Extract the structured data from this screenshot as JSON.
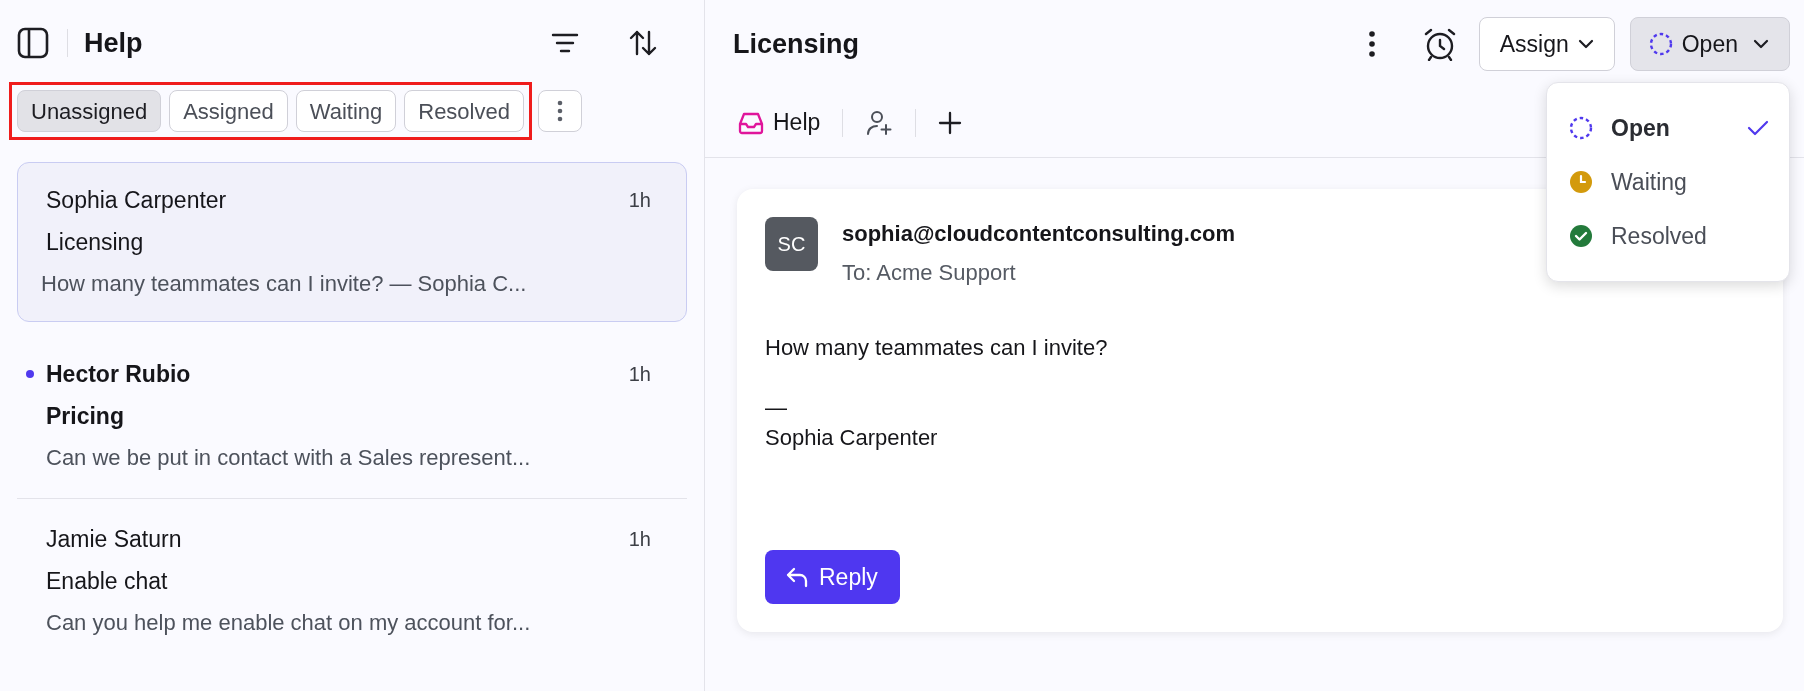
{
  "sidebar": {
    "title": "Help",
    "filters_highlighted": true,
    "filters": [
      {
        "label": "Unassigned",
        "selected": true
      },
      {
        "label": "Assigned",
        "selected": false
      },
      {
        "label": "Waiting",
        "selected": false
      },
      {
        "label": "Resolved",
        "selected": false
      }
    ],
    "conversations": [
      {
        "name": "Sophia Carpenter",
        "time": "1h",
        "subject": "Licensing",
        "preview": "How many teammates can I invite? — Sophia C...",
        "unread": false,
        "selected": true
      },
      {
        "name": "Hector Rubio",
        "time": "1h",
        "subject": "Pricing",
        "preview": "Can we be put in contact with a Sales represent...",
        "unread": true,
        "selected": false
      },
      {
        "name": "Jamie Saturn",
        "time": "1h",
        "subject": "Enable chat",
        "preview": "Can you help me enable chat on my account for...",
        "unread": false,
        "selected": false
      }
    ]
  },
  "conversation": {
    "title": "Licensing",
    "assign_button": "Assign",
    "status_button": "Open",
    "inbox_tab": "Help",
    "message": {
      "initials": "SC",
      "sender": "sophia@cloudcontentconsulting.com",
      "to": "To: Acme Support",
      "body": "How many teammates can I invite?",
      "dash": "—",
      "signature": "Sophia Carpenter"
    },
    "reply_button": "Reply"
  },
  "status_menu": {
    "items": [
      {
        "kind": "open",
        "label": "Open",
        "selected": true
      },
      {
        "kind": "waiting",
        "label": "Waiting",
        "selected": false
      },
      {
        "kind": "resolved",
        "label": "Resolved",
        "selected": false
      }
    ]
  }
}
